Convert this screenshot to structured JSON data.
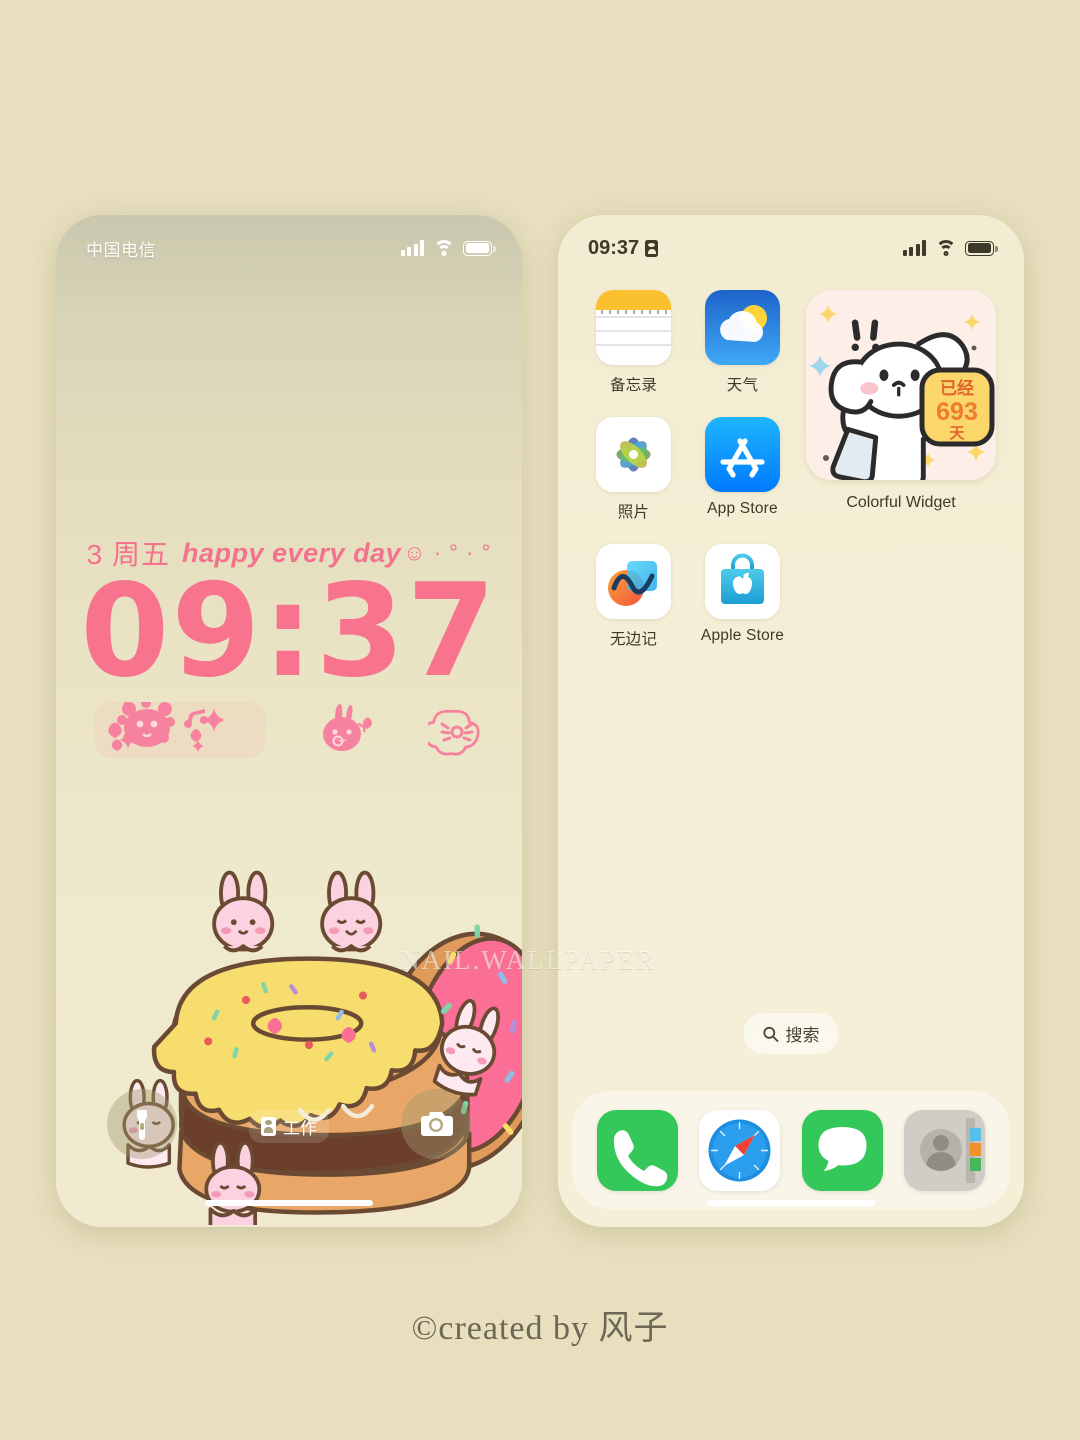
{
  "page": {
    "background_color": "#e7dfbd",
    "watermark": "NAIL.WALLPAPER",
    "footer_credit": "©created by 风子"
  },
  "lock_screen": {
    "status_bar": {
      "carrier": "中国电信",
      "signal_icon": "cellular-bars-icon",
      "wifi_icon": "wifi-icon",
      "battery_icon": "battery-full-icon"
    },
    "date": "3 周五",
    "date_suffix": "happy every day",
    "date_emoji": "☺ · ° · °",
    "time": "09:37",
    "time_color": "#f8738e",
    "widgets": [
      {
        "name": "bear-sparkle-widget",
        "label": ""
      },
      {
        "name": "bunny-widget",
        "label": ""
      },
      {
        "name": "flower-widget",
        "label": ""
      }
    ],
    "wallpaper_art": "donut-bunnies-illustration",
    "bottom_controls": {
      "flashlight": "flashlight-icon",
      "camera": "camera-icon",
      "focus_label": "工作",
      "focus_icon": "focus-badge-icon"
    }
  },
  "home_screen": {
    "status_bar": {
      "time": "09:37",
      "lock_icon": "privacy-lock-icon",
      "signal_icon": "cellular-bars-icon",
      "wifi_icon": "wifi-icon",
      "battery_icon": "battery-full-icon"
    },
    "apps": [
      [
        {
          "label": "备忘录",
          "icon": "notes-icon"
        },
        {
          "label": "天气",
          "icon": "weather-icon"
        }
      ],
      [
        {
          "label": "照片",
          "icon": "photos-icon"
        },
        {
          "label": "App Store",
          "icon": "app-store-icon"
        }
      ],
      [
        {
          "label": "无边记",
          "icon": "freeform-icon"
        },
        {
          "label": "Apple Store",
          "icon": "apple-store-icon"
        }
      ]
    ],
    "widget": {
      "label": "Colorful Widget",
      "art": "white-puppy-illustration",
      "counter_prefix": "已经",
      "counter_value": "693",
      "counter_suffix": "天",
      "counter_bg": "#fbd66a",
      "counter_value_color": "#f07b30"
    },
    "search": {
      "label": "搜索",
      "icon": "search-icon"
    },
    "dock": [
      {
        "label": "Phone",
        "icon": "phone-icon"
      },
      {
        "label": "Safari",
        "icon": "safari-icon"
      },
      {
        "label": "Messages",
        "icon": "messages-icon"
      },
      {
        "label": "Contacts",
        "icon": "contacts-icon"
      }
    ],
    "wallpaper_art": "donut-bunnies-illustration"
  }
}
